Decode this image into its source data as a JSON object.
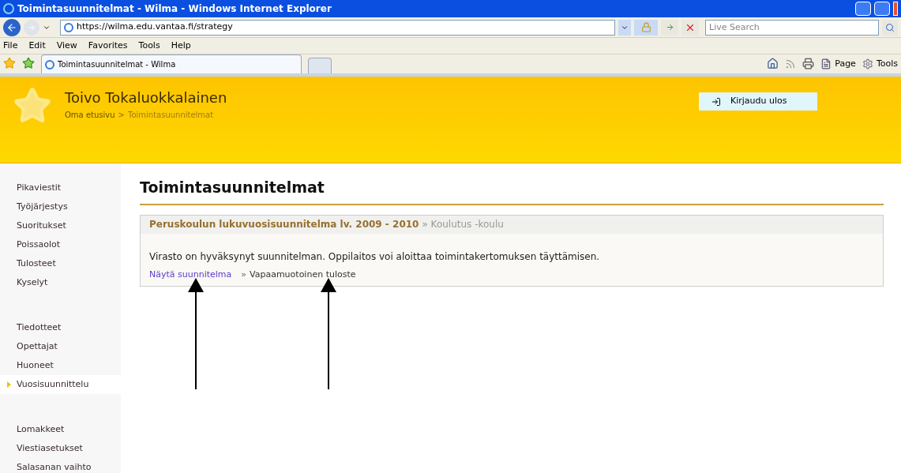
{
  "window": {
    "title": "Toimintasuunnitelmat - Wilma - Windows Internet Explorer"
  },
  "address_bar": {
    "url": "https://wilma.edu.vantaa.fi/strategy"
  },
  "search": {
    "placeholder": "Live Search"
  },
  "menu_bar": [
    "File",
    "Edit",
    "View",
    "Favorites",
    "Tools",
    "Help"
  ],
  "tabs": [
    {
      "label": "Toimintasuunnitelmat - Wilma",
      "selected": true
    }
  ],
  "command_bar": [
    "Page",
    "Tools"
  ],
  "header": {
    "user": "Toivo Tokaluokkalainen",
    "breadcrumb": [
      {
        "label": "Oma etusivu"
      },
      {
        "label": "Toimintasuunnitelmat"
      }
    ],
    "breadcrumb_separator": ">",
    "logout": "Kirjaudu ulos"
  },
  "sidebar": {
    "groups": [
      [
        {
          "label": "Pikaviestit",
          "selected": false
        },
        {
          "label": "Työjärjestys",
          "selected": false
        },
        {
          "label": "Suoritukset",
          "selected": false
        },
        {
          "label": "Poissaolot",
          "selected": false
        },
        {
          "label": "Tulosteet",
          "selected": false
        },
        {
          "label": "Kyselyt",
          "selected": false
        }
      ],
      [
        {
          "label": "Tiedotteet",
          "selected": false
        },
        {
          "label": "Opettajat",
          "selected": false
        },
        {
          "label": "Huoneet",
          "selected": false
        },
        {
          "label": "Vuosisuunnittelu",
          "selected": true
        }
      ],
      [
        {
          "label": "Lomakkeet",
          "selected": false
        },
        {
          "label": "Viestiasetukset",
          "selected": false
        },
        {
          "label": "Salasanan vaihto",
          "selected": false
        }
      ]
    ]
  },
  "content": {
    "title": "Toimintasuunnitelmat",
    "plan": {
      "title": "Peruskoulun lukuvuosisuunnitelma lv. 2009 - 2010",
      "school_separator": "»",
      "school": "Koulutus -koulu",
      "link_marker": "»",
      "message": "Virasto on hyväksynyt suunnitelman. Oppilaitos voi aloittaa toimintakertomuksen täyttämisen.",
      "links": [
        "Näytä suunnitelma",
        "Vapaamuotoinen tuloste"
      ]
    }
  }
}
